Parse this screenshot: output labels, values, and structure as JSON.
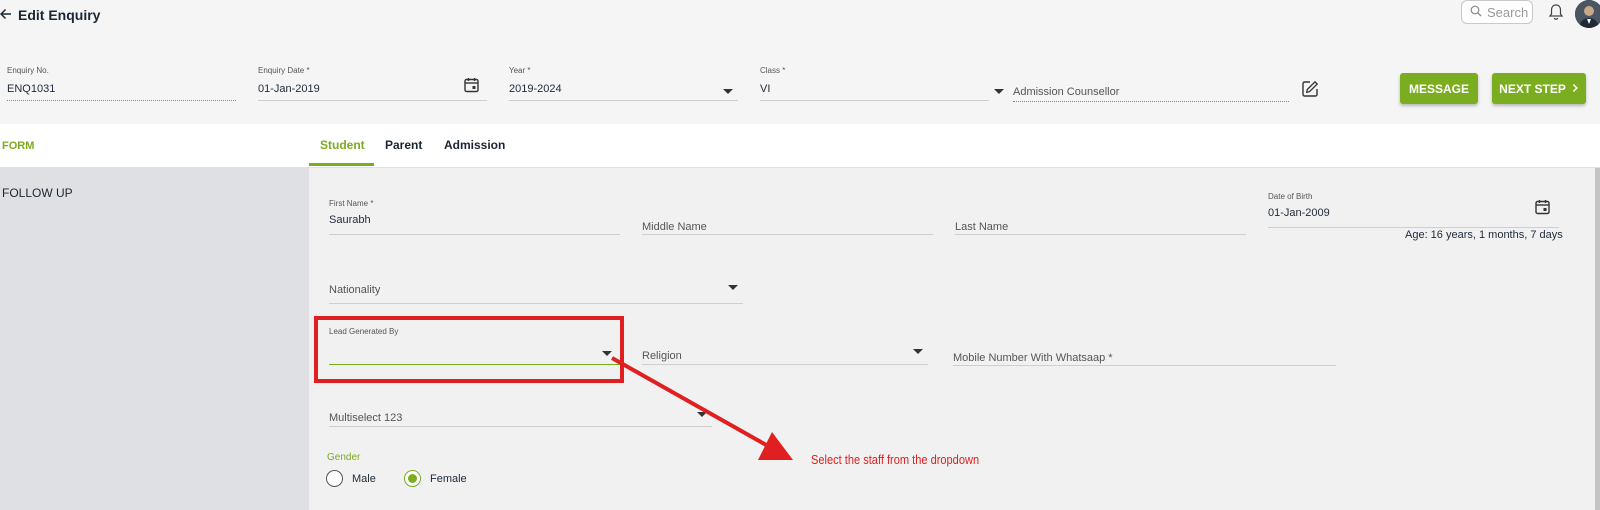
{
  "header": {
    "title": "Edit Enquiry",
    "search_placeholder": "Search"
  },
  "enquiry": {
    "no_label": "Enquiry No.",
    "no_value": "ENQ1031",
    "date_label": "Enquiry Date *",
    "date_value": "01-Jan-2019",
    "year_label": "Year *",
    "year_value": "2019-2024",
    "class_label": "Class *",
    "class_value": "VI",
    "counsellor_placeholder": "Admission Counsellor"
  },
  "actions": {
    "message": "MESSAGE",
    "next_step": "NEXT STEP"
  },
  "sidebar": {
    "form": "FORM",
    "follow_up": "FOLLOW UP"
  },
  "tabs": [
    "Student",
    "Parent",
    "Admission"
  ],
  "student": {
    "first_name_label": "First Name *",
    "first_name_value": "Saurabh",
    "middle_name_placeholder": "Middle Name",
    "last_name_placeholder": "Last Name",
    "dob_label": "Date of Birth",
    "dob_value": "01-Jan-2009",
    "age": "Age: 16 years, 1 months, 7 days",
    "nationality_placeholder": "Nationality",
    "lead_label": "Lead Generated By",
    "lead_value": "",
    "religion_placeholder": "Religion",
    "mobile_placeholder": "Mobile Number With Whatsaap *",
    "multiselect_placeholder": "Multiselect 123",
    "gender_label": "Gender",
    "gender_options": [
      "Male",
      "Female"
    ],
    "gender_selected": "Female"
  },
  "annotation": {
    "text": "Select the staff from the dropdown",
    "color": "#e02020"
  },
  "colors": {
    "accent": "#7aad1f",
    "sidebar_bg": "#dfe0e4"
  },
  "icons": [
    "back-arrow-icon",
    "search-icon",
    "bell-icon",
    "calendar-icon",
    "edit-icon",
    "chevron-right-icon",
    "caret-down-icon"
  ]
}
